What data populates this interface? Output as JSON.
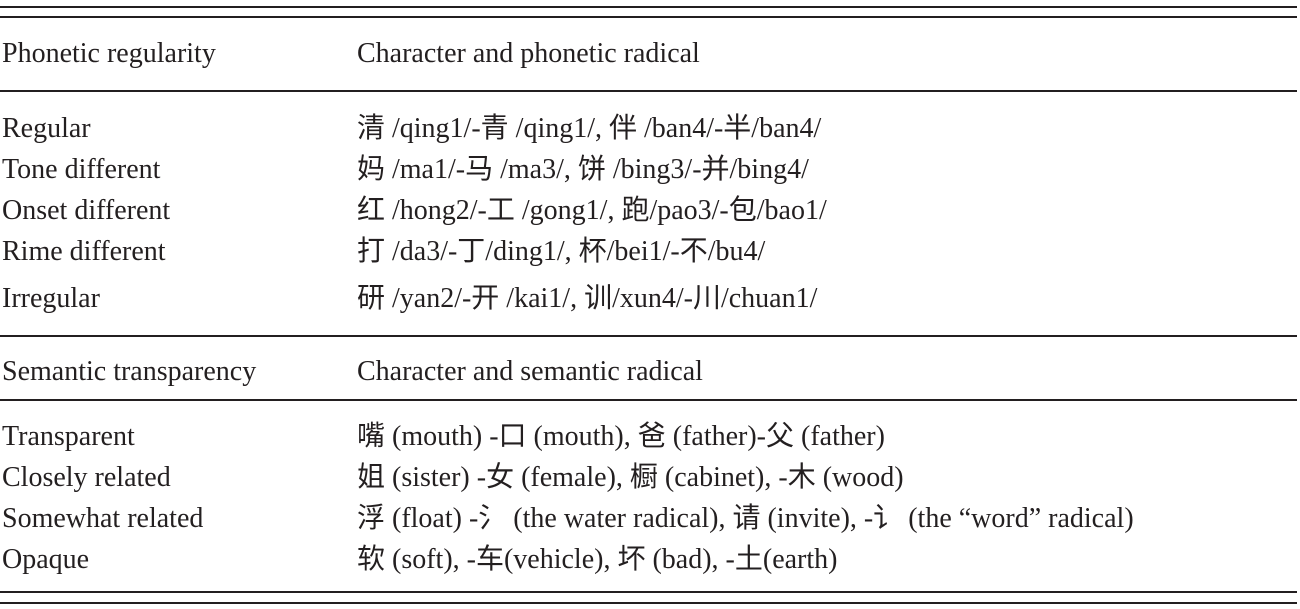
{
  "table": {
    "section1": {
      "header": {
        "col1": "Phonetic regularity",
        "col2": "Character and phonetic radical"
      },
      "rows": [
        {
          "category": "Regular",
          "example": "清 /qing1/-青 /qing1/, 伴 /ban4/-半/ban4/"
        },
        {
          "category": "Tone different",
          "example": "妈 /ma1/-马 /ma3/, 饼 /bing3/-并/bing4/"
        },
        {
          "category": "Onset different",
          "example": "红 /hong2/-工 /gong1/, 跑/pao3/-包/bao1/"
        },
        {
          "category": "Rime different",
          "example": "打 /da3/-丁/ding1/, 杯/bei1/-不/bu4/"
        },
        {
          "category": "Irregular",
          "example": "研 /yan2/-开 /kai1/, 训/xun4/-川/chuan1/"
        }
      ]
    },
    "section2": {
      "header": {
        "col1": "Semantic transparency",
        "col2": "Character and semantic radical"
      },
      "rows": [
        {
          "category": "Transparent",
          "example": "嘴 (mouth) -口 (mouth), 爸 (father)-父 (father)"
        },
        {
          "category": "Closely related",
          "example": "姐 (sister) -女 (female), 橱 (cabinet), -木 (wood)"
        },
        {
          "category": "Somewhat related",
          "example": "浮 (float) -氵 (the water radical), 请 (invite), -讠 (the “word” radical)"
        },
        {
          "category": "Opaque",
          "example": "软 (soft), -车(vehicle), 坏 (bad), -土(earth)"
        }
      ]
    }
  }
}
